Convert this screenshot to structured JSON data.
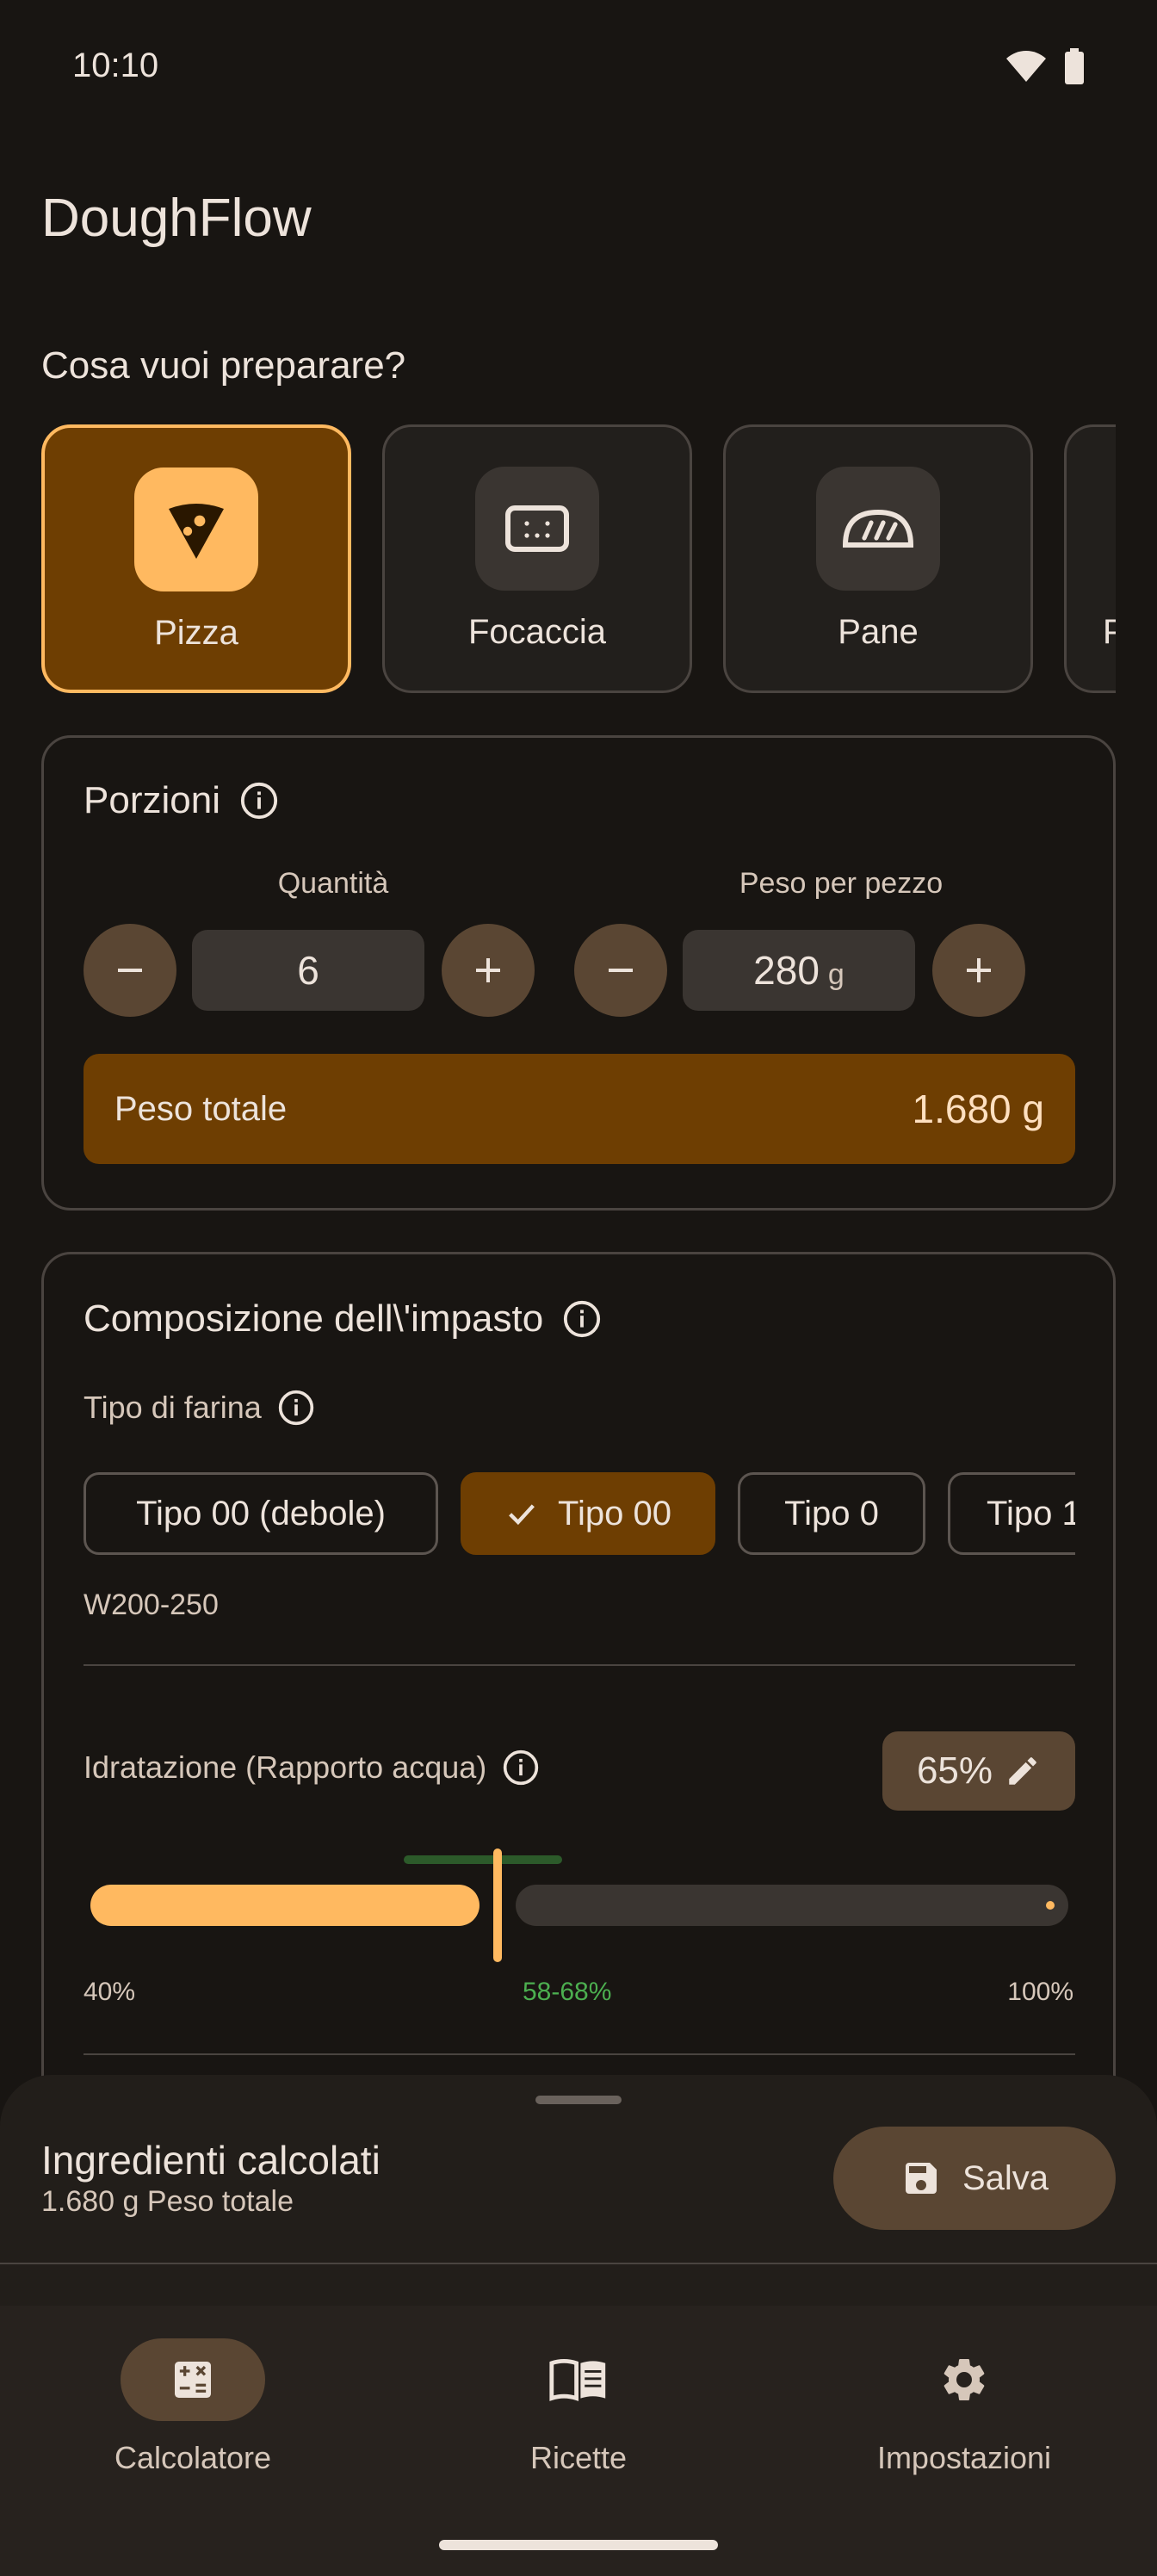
{
  "status_bar": {
    "time": "10:10"
  },
  "app": {
    "title": "DoughFlow"
  },
  "question": "Cosa vuoi preparare?",
  "types": [
    {
      "label": "Pizza",
      "icon": "pizza-icon",
      "selected": true
    },
    {
      "label": "Focaccia",
      "icon": "focaccia-icon",
      "selected": false
    },
    {
      "label": "Pane",
      "icon": "bread-icon",
      "selected": false
    },
    {
      "label": "P",
      "icon": "",
      "selected": false
    }
  ],
  "portions": {
    "title": "Porzioni",
    "quantity_label": "Quantità",
    "quantity_value": "6",
    "weight_label": "Peso per pezzo",
    "weight_value": "280",
    "weight_unit": "g",
    "total_label": "Peso totale",
    "total_value": "1.680 g"
  },
  "composition": {
    "title": "Composizione dell\\'impasto",
    "flour_label": "Tipo di farina",
    "flour_options": [
      "Tipo 00 (debole)",
      "Tipo 00",
      "Tipo 0",
      "Tipo 1"
    ],
    "flour_selected_index": 1,
    "flour_strength": "W200-250",
    "hydration_label": "Idratazione (Rapporto acqua)",
    "hydration_value": "65%",
    "hydration_fraction": 0.65,
    "slider_min": "40%",
    "slider_max": "100%",
    "slider_range": "58-68%"
  },
  "sheet": {
    "title": "Ingredienti calcolati",
    "subtitle": "1.680 g Peso totale",
    "save_label": "Salva"
  },
  "nav": {
    "items": [
      {
        "label": "Calcolatore",
        "icon": "calculator-icon",
        "active": true
      },
      {
        "label": "Ricette",
        "icon": "book-icon",
        "active": false
      },
      {
        "label": "Impostazioni",
        "icon": "gear-icon",
        "active": false
      }
    ]
  },
  "colors": {
    "background": "#181512",
    "accent": "#FFB960",
    "accent_container": "#6E3E02",
    "range_green": "#4CAF50"
  }
}
